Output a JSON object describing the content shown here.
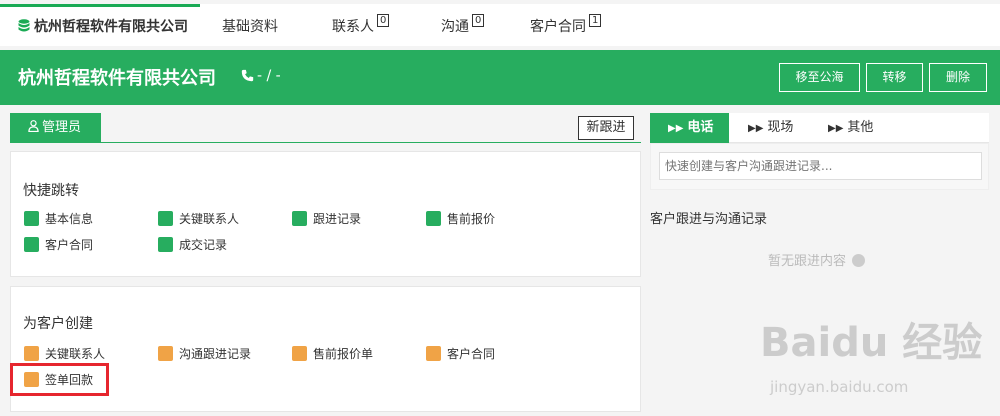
{
  "top_tabs": [
    {
      "label": "杭州哲程软件有限共公司",
      "count": "",
      "active": true
    },
    {
      "label": "基础资料",
      "count": "",
      "active": false
    },
    {
      "label": "联系人",
      "count": "0",
      "active": false
    },
    {
      "label": "沟通",
      "count": "0",
      "active": false
    },
    {
      "label": "客户合同",
      "count": "1",
      "active": false
    }
  ],
  "header": {
    "company_name": "杭州哲程软件有限共公司",
    "phone_text": "- / -",
    "buttons": {
      "move_to_pool": "移至公海",
      "transfer": "转移",
      "delete": "删除"
    }
  },
  "left_panel": {
    "owner_tab": "管理员",
    "new_follow_button": "新跟进",
    "quick_jump": {
      "title": "快捷跳转",
      "items": [
        "基本信息",
        "关键联系人",
        "跟进记录",
        "售前报价",
        "客户合同",
        "成交记录"
      ]
    },
    "create_for_customer": {
      "title": "为客户创建",
      "items": [
        "关键联系人",
        "沟通跟进记录",
        "售前报价单",
        "客户合同",
        "签单回款"
      ]
    }
  },
  "right_panel": {
    "tabs": [
      "电话",
      "现场",
      "其他"
    ],
    "quick_input_placeholder": "快速创建与客户沟通跟进记录...",
    "records_title": "客户跟进与沟通记录",
    "empty_text": "暂无跟进内容"
  },
  "watermark": {
    "logo_text": "Baidu 经验",
    "url_text": "jingyan.baidu.com"
  },
  "colors": {
    "brand_green": "#27ad5f",
    "accent_orange": "#f0a346",
    "highlight_red": "#e6262e"
  }
}
